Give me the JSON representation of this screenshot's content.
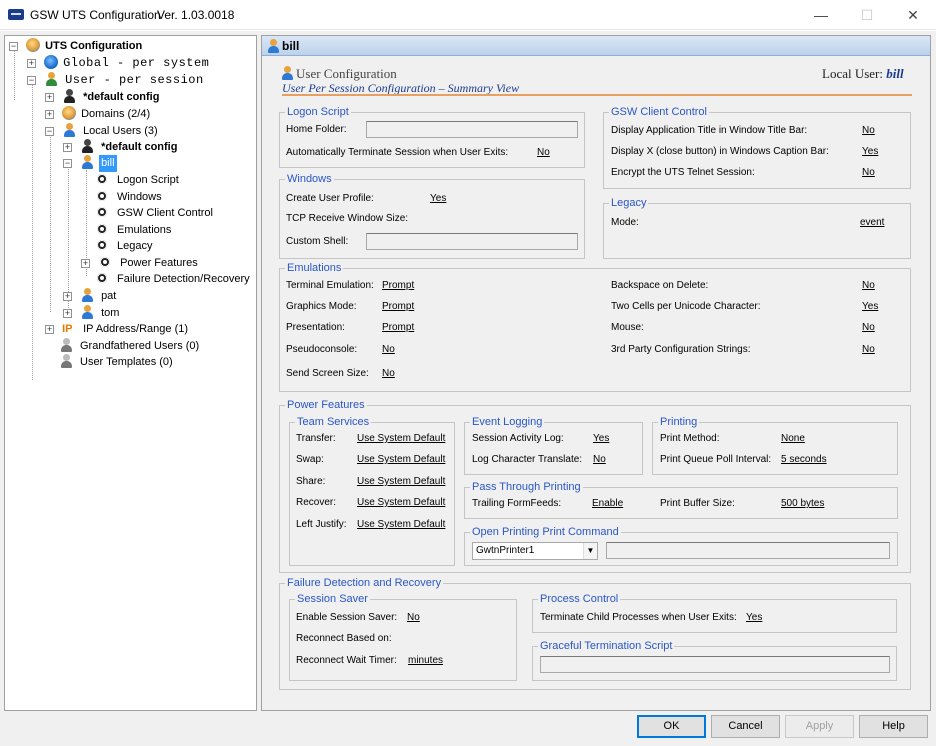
{
  "window": {
    "title": "GSW UTS Configuration",
    "version": "Ver. 1.03.0018",
    "minimize": "—",
    "maximize": "☐",
    "close": "✕"
  },
  "tree": {
    "root": "UTS Configuration",
    "global": "Global - per system",
    "user": "User  - per session",
    "default_config": "*default config",
    "domains": "Domains (2/4)",
    "local_users": "Local Users (3)",
    "default_config_2": "*default config",
    "bill": "bill",
    "children": [
      "Logon Script",
      "Windows",
      "GSW Client Control",
      "Emulations",
      "Legacy",
      "Power Features",
      "Failure Detection/Recovery"
    ],
    "pat": "pat",
    "tom": "tom",
    "ip": "IP Address/Range (1)",
    "grandfathered": "Grandfathered Users (0)",
    "templates": "User Templates (0)"
  },
  "panel": {
    "header": "bill",
    "title": "User Configuration",
    "local_user_label": "Local User:",
    "local_user": "bill",
    "subtitle": "User Per Session Configuration – Summary View"
  },
  "logon": {
    "legend": "Logon Script",
    "home_folder": "Home Folder:",
    "home_folder_value": "",
    "auto_terminate": "Automatically Terminate Session when User Exits:",
    "auto_terminate_value": "No"
  },
  "windows": {
    "legend": "Windows",
    "create_profile": "Create User Profile:",
    "create_profile_value": "Yes",
    "tcp": "TCP Receive Window Size:",
    "custom_shell": "Custom Shell:",
    "custom_shell_value": ""
  },
  "client": {
    "legend": "GSW Client Control",
    "display_title": "Display Application Title in Window Title Bar:",
    "display_title_value": "No",
    "display_x": "Display X (close button) in Windows Caption Bar:",
    "display_x_value": "Yes",
    "encrypt": "Encrypt the UTS Telnet Session:",
    "encrypt_value": "No"
  },
  "legacy": {
    "legend": "Legacy",
    "mode": "Mode:",
    "mode_value": "event"
  },
  "emulations": {
    "legend": "Emulations",
    "terminal": "Terminal Emulation:",
    "terminal_value": "Prompt",
    "graphics": "Graphics Mode:",
    "graphics_value": "Prompt",
    "presentation": "Presentation:",
    "presentation_value": "Prompt",
    "pseudo": "Pseudoconsole:",
    "pseudo_value": "No",
    "send_screen": "Send Screen Size:",
    "send_screen_value": "No",
    "backspace": "Backspace on Delete:",
    "backspace_value": "No",
    "two_cells": "Two Cells per Unicode Character:",
    "two_cells_value": "Yes",
    "mouse": "Mouse:",
    "mouse_value": "No",
    "third_party": "3rd Party Configuration Strings:",
    "third_party_value": "No"
  },
  "power": {
    "legend": "Power Features",
    "team": {
      "legend": "Team Services",
      "transfer": "Transfer:",
      "transfer_value": "Use System Default",
      "swap": "Swap:",
      "swap_value": "Use System Default",
      "share": "Share:",
      "share_value": "Use System Default",
      "recover": "Recover:",
      "recover_value": "Use System Default",
      "left_justify": "Left Justify:",
      "left_justify_value": "Use System Default"
    },
    "event": {
      "legend": "Event Logging",
      "activity": "Session Activity Log:",
      "activity_value": "Yes",
      "translate": "Log Character Translate:",
      "translate_value": "No"
    },
    "printing": {
      "legend": "Printing",
      "method": "Print Method:",
      "method_value": "None",
      "poll": "Print Queue Poll Interval:",
      "poll_value": "5 seconds"
    },
    "pass": {
      "legend": "Pass Through Printing",
      "formfeeds": "Trailing FormFeeds:",
      "formfeeds_value": "Enable",
      "buffer": "Print Buffer Size:",
      "buffer_value": "500 bytes"
    },
    "open_print": {
      "legend": "Open Printing Print Command",
      "printer": "GwtnPrinter1",
      "command": ""
    }
  },
  "failure": {
    "legend": "Failure Detection and Recovery",
    "saver": {
      "legend": "Session Saver",
      "enable": "Enable Session Saver:",
      "enable_value": "No",
      "reconnect_based": "Reconnect Based on:",
      "wait": "Reconnect Wait Timer:",
      "wait_value": "minutes"
    },
    "process": {
      "legend": "Process Control",
      "terminate": "Terminate Child Processes when User Exits:",
      "terminate_value": "Yes"
    },
    "graceful": {
      "legend": "Graceful Termination Script",
      "value": ""
    }
  },
  "buttons": {
    "ok": "OK",
    "cancel": "Cancel",
    "apply": "Apply",
    "help": "Help"
  }
}
